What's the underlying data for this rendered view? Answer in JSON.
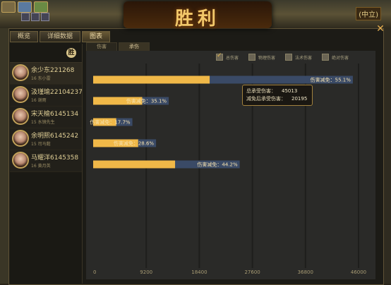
{
  "header": {
    "title": "胜利",
    "server_tag": "(中立)"
  },
  "tabs": [
    "概览",
    "详细数据",
    "图表"
  ],
  "sub_tabs": [
    "伤害",
    "承伤"
  ],
  "filters": [
    {
      "label": "总伤害",
      "checked": true
    },
    {
      "label": "物理伤害",
      "checked": false
    },
    {
      "label": "法术伤害",
      "checked": false
    },
    {
      "label": "绝对伤害",
      "checked": false
    }
  ],
  "roster_badge": "胜",
  "players": [
    {
      "name": "余少东221268",
      "level": "16",
      "title": "东小雷"
    },
    {
      "name": "汲瑾瑜22104237",
      "level": "16",
      "title": "谢雨"
    },
    {
      "name": "宋天榆6145134",
      "level": "15",
      "title": "水镜先生"
    },
    {
      "name": "余明熙6145242",
      "level": "15",
      "title": "司马懿"
    },
    {
      "name": "马耀洋6145358",
      "level": "16",
      "title": "黄月英"
    }
  ],
  "tooltip": {
    "total_label": "总承受伤害：",
    "total_value": "45013",
    "after_label": "减免后承受伤害：",
    "after_value": "20195"
  },
  "colors": {
    "bar": "#f0b848",
    "bar_track": "#3a4a66",
    "accent": "#e8b052"
  },
  "chart_data": {
    "type": "bar",
    "orientation": "horizontal",
    "categories": [
      "余少东221268",
      "汲瑾瑜22104237",
      "宋天榆6145134",
      "余明熙6145242",
      "马耀洋6145358"
    ],
    "series": [
      {
        "name": "减免后承受伤害",
        "values": [
          20195,
          8500,
          4000,
          7800,
          14200
        ]
      },
      {
        "name": "总承受伤害",
        "values": [
          45013,
          13100,
          6800,
          10900,
          25400
        ]
      }
    ],
    "data_labels": [
      "伤害减免：55.1%",
      "伤害减免：35.1%",
      "伤害减免：17.7%",
      "伤害减免：28.6%",
      "伤害减免：44.2%"
    ],
    "x_ticks": [
      0,
      9200,
      18400,
      27600,
      36800,
      46000
    ],
    "xlim": [
      0,
      46000
    ],
    "grid": true
  }
}
